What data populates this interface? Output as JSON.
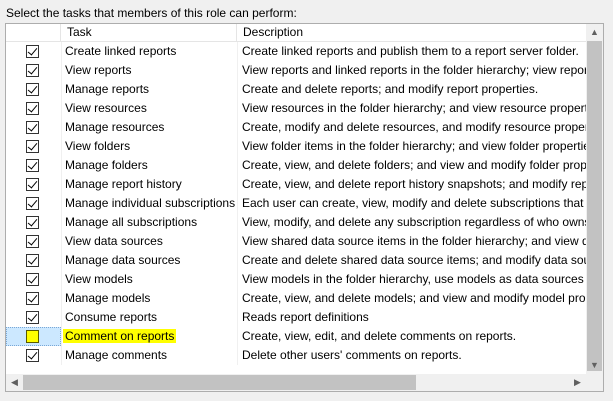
{
  "prompt": "Select the tasks that members of this role can perform:",
  "columns": {
    "check": "",
    "task": "Task",
    "description": "Description"
  },
  "rows": [
    {
      "task": "Create linked reports",
      "description": "Create linked reports and publish them to a report server folder.",
      "checked": true
    },
    {
      "task": "View reports",
      "description": "View reports and linked reports in the folder hierarchy; view report history s",
      "checked": true
    },
    {
      "task": "Manage reports",
      "description": "Create and delete reports; and modify report properties.",
      "checked": true
    },
    {
      "task": "View resources",
      "description": "View resources in the folder hierarchy; and view resource properties.",
      "checked": true
    },
    {
      "task": "Manage resources",
      "description": "Create, modify and delete resources, and modify resource properties.",
      "checked": true
    },
    {
      "task": "View folders",
      "description": "View folder items in the folder hierarchy; and view folder properties.",
      "checked": true
    },
    {
      "task": "Manage folders",
      "description": "Create, view, and delete folders; and view and modify folder properties.",
      "checked": true
    },
    {
      "task": "Manage report history",
      "description": "Create, view, and delete report history snapshots; and modify report histor",
      "checked": true
    },
    {
      "task": "Manage individual subscriptions",
      "description": "Each user can create, view, modify and delete subscriptions that he or sh",
      "checked": true
    },
    {
      "task": "Manage all subscriptions",
      "description": "View, modify, and delete any subscription regardless of who owns the sub",
      "checked": true
    },
    {
      "task": "View data sources",
      "description": "View shared data source items in the folder hierarchy; and view data sour",
      "checked": true
    },
    {
      "task": "Manage data sources",
      "description": "Create and delete shared data source items; and modify data source prop",
      "checked": true
    },
    {
      "task": "View models",
      "description": "View models in the folder hierarchy, use models as data sources for a repo",
      "checked": true
    },
    {
      "task": "Manage models",
      "description": "Create, view, and delete models; and view and modify model properties.",
      "checked": true
    },
    {
      "task": "Consume reports",
      "description": "Reads report definitions",
      "checked": true
    },
    {
      "task": "Comment on reports",
      "description": "Create, view, edit, and delete comments on reports.",
      "checked": false,
      "selected": true,
      "highlighted": true
    },
    {
      "task": "Manage comments",
      "description": "Delete other users' comments on reports.",
      "checked": true
    }
  ],
  "scrollbars": {
    "up_arrow": "▲",
    "down_arrow": "▼",
    "left_arrow": "◀",
    "right_arrow": "▶"
  }
}
